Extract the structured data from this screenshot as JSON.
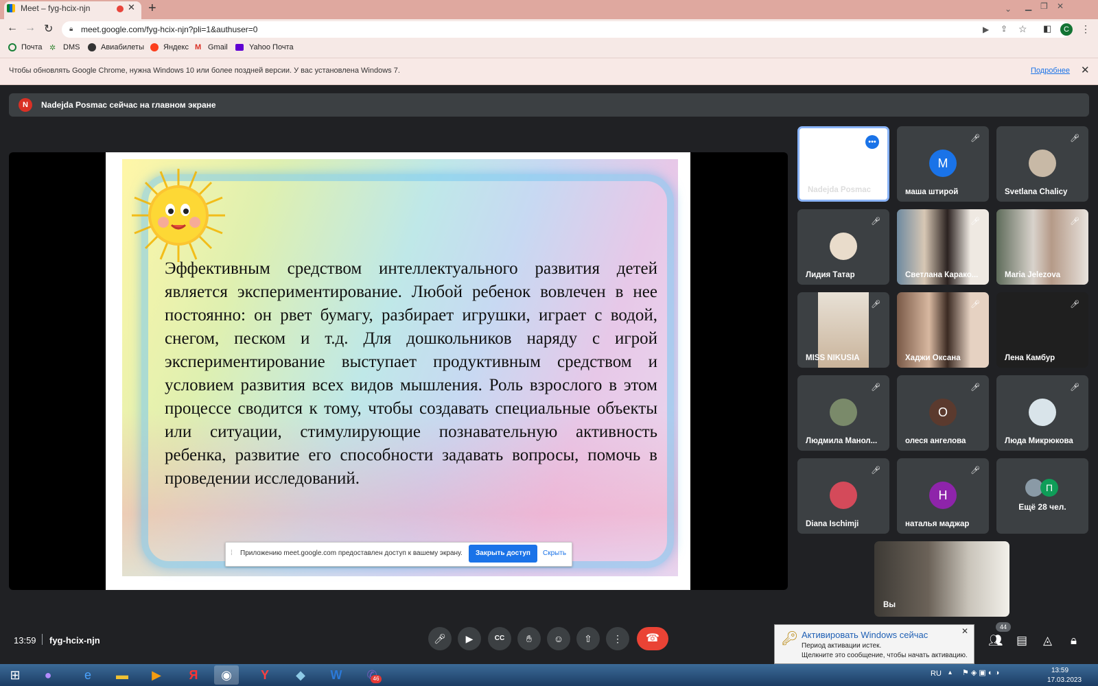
{
  "browser": {
    "tab_title": "Meet – fyg-hcix-njn",
    "tab_close": "✕",
    "new_tab": "+",
    "url": "meet.google.com/fyg-hcix-njn?pli=1&authuser=0",
    "profile_initial": "C",
    "bookmarks": [
      "Почта",
      "DMS",
      "Авиабилеты",
      "Яндекс",
      "Gmail",
      "Yahoo Почта"
    ],
    "infobar_text": "Чтобы обновлять Google Chrome, нужна Windows 10 или более поздней версии. У вас установлена Windows 7.",
    "infobar_link": "Подробнее",
    "infobar_close": "✕"
  },
  "meet": {
    "presenter_initial": "N",
    "presenter_banner": "Nadejda Posmac сейчас на главном экране",
    "slide_text": "Эффективным средством интеллектуального развития детей  является экспериментирование. Любой ребенок вовлечен в нее постоянно: он рвет бумагу, разбирает игрушки, играет с водой, снегом, песком и т.д. Для дошкольников наряду с игрой экспериментирование выступает продуктивным средством и условием развития всех видов мышления. Роль взрослого в этом процессе сводится к тому, чтобы создавать специальные объекты или ситуации, стимулирующие познавательную активность ребенка, развитие его способности задавать вопросы, помочь в проведении исследований.",
    "share_notice": "Приложению meet.google.com предоставлен доступ к вашему экрану.",
    "share_stop": "Закрыть доступ",
    "share_hide": "Скрыть",
    "participants": [
      {
        "name": "Nadejda Posmac",
        "kind": "presenting"
      },
      {
        "name": "маша штирой",
        "initial": "M",
        "color": "#1a73e8"
      },
      {
        "name": "Svetlana Chalicy",
        "kind": "photo"
      },
      {
        "name": "Лидия Татар",
        "kind": "photo"
      },
      {
        "name": "Светлана Карако...",
        "kind": "video"
      },
      {
        "name": "Maria Jelezova",
        "kind": "video"
      },
      {
        "name": "MISS NIKUSIA",
        "kind": "video"
      },
      {
        "name": "Хаджи Оксана",
        "kind": "video"
      },
      {
        "name": "Лена Камбур",
        "kind": "off"
      },
      {
        "name": "Людмила Манол...",
        "kind": "photo"
      },
      {
        "name": "олеся ангелова",
        "initial": "О",
        "color": "#5b3a2e"
      },
      {
        "name": "Люда Микрюкова",
        "kind": "photo"
      },
      {
        "name": "Diana Ischimji",
        "kind": "photo"
      },
      {
        "name": "наталья маджар",
        "initial": "Н",
        "color": "#8e24aa"
      }
    ],
    "more_people": "Ещё 28 чел.",
    "more_initial": "П",
    "self_label": "Вы",
    "time": "13:59",
    "meeting_code": "fyg-hcix-njn",
    "people_count": "44"
  },
  "windows": {
    "activate_title": "Активировать Windows сейчас",
    "activate_line1": "Период активации истек.",
    "activate_line2": "Щелкните это сообщение, чтобы начать активацию.",
    "activate_close": "✕",
    "tray_lang": "RU",
    "tray_time": "13:59",
    "tray_date": "17.03.2023",
    "taskbar_badge": "46"
  }
}
